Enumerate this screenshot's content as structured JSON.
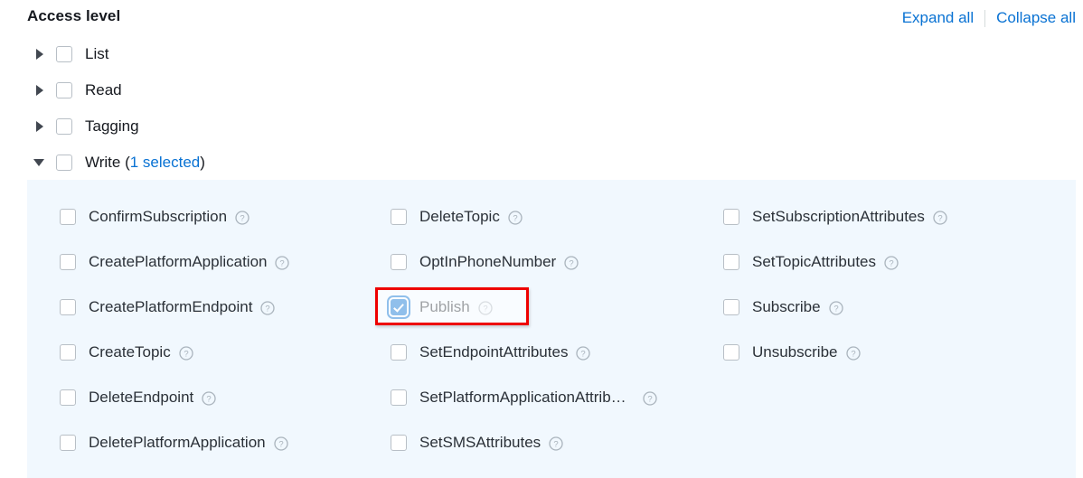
{
  "header": {
    "title": "Access level",
    "expand_all_label": "Expand all",
    "collapse_all_label": "Collapse all"
  },
  "colors": {
    "link": "#0972d3",
    "panel_background": "#f1f8fe",
    "checkbox_checked": "#0972d3",
    "annotation": "#ee0000",
    "text": "#16191f"
  },
  "groups": [
    {
      "label": "List",
      "expanded": false,
      "checked": false,
      "suffix_open": "",
      "count": "",
      "suffix_close": ""
    },
    {
      "label": "Read",
      "expanded": false,
      "checked": false,
      "suffix_open": "",
      "count": "",
      "suffix_close": ""
    },
    {
      "label": "Tagging",
      "expanded": false,
      "checked": false,
      "suffix_open": "",
      "count": "",
      "suffix_close": ""
    },
    {
      "label": "Write",
      "expanded": true,
      "checked": false,
      "suffix_open": " (",
      "count": "1 selected",
      "suffix_close": ")"
    }
  ],
  "write_actions": {
    "column1": [
      {
        "label": "ConfirmSubscription",
        "checked": false,
        "truncated": false
      },
      {
        "label": "CreatePlatformApplication",
        "checked": false,
        "truncated": false
      },
      {
        "label": "CreatePlatformEndpoint",
        "checked": false,
        "truncated": false
      },
      {
        "label": "CreateTopic",
        "checked": false,
        "truncated": false
      },
      {
        "label": "DeleteEndpoint",
        "checked": false,
        "truncated": false
      },
      {
        "label": "DeletePlatformApplication",
        "checked": false,
        "truncated": false
      }
    ],
    "column2": [
      {
        "label": "DeleteTopic",
        "checked": false,
        "truncated": false
      },
      {
        "label": "OptInPhoneNumber",
        "checked": false,
        "truncated": false
      },
      {
        "label": "Publish",
        "checked": true,
        "truncated": false
      },
      {
        "label": "SetEndpointAttributes",
        "checked": false,
        "truncated": false
      },
      {
        "label": "SetPlatformApplicationAttrib…",
        "checked": false,
        "truncated": true
      },
      {
        "label": "SetSMSAttributes",
        "checked": false,
        "truncated": false
      }
    ],
    "column3": [
      {
        "label": "SetSubscriptionAttributes",
        "checked": false,
        "truncated": false
      },
      {
        "label": "SetTopicAttributes",
        "checked": false,
        "truncated": false
      },
      {
        "label": "Subscribe",
        "checked": false,
        "truncated": false
      },
      {
        "label": "Unsubscribe",
        "checked": false,
        "truncated": false
      }
    ]
  },
  "icons": {
    "info": "help-circle-icon",
    "twisty_collapsed": "caret-right-icon",
    "twisty_expanded": "caret-down-icon"
  }
}
